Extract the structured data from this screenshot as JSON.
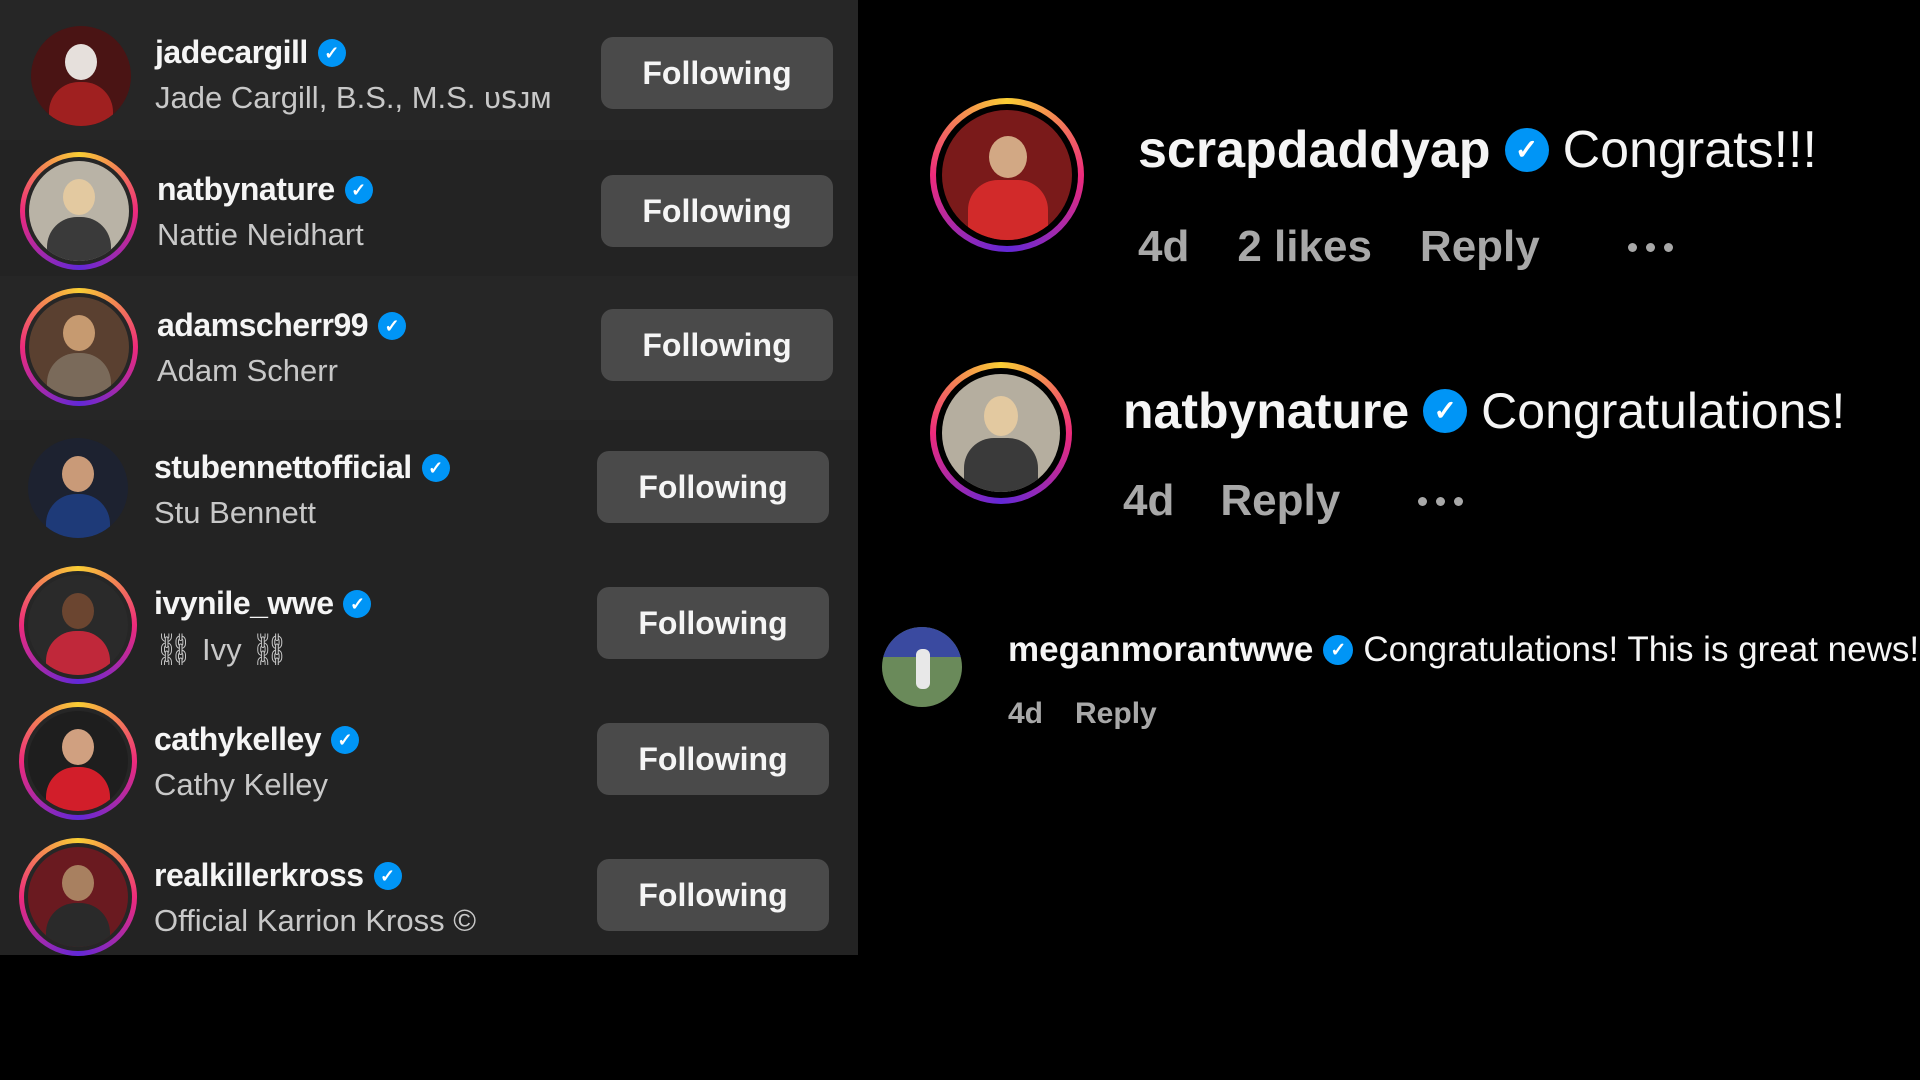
{
  "following_list": {
    "button_label": "Following",
    "accounts": [
      {
        "handle": "jadecargill",
        "name": "Jade Cargill, B.S., M.S. ᴜꜱᴊᴍ",
        "ring": false
      },
      {
        "handle": "natbynature",
        "name": "Nattie Neidhart",
        "ring": true
      },
      {
        "handle": "adamscherr99",
        "name": "Adam Scherr",
        "ring": true
      },
      {
        "handle": "stubennettofficial",
        "name": "Stu Bennett",
        "ring": false
      },
      {
        "handle": "ivynile_wwe",
        "name": "⛓ Ivy ⛓",
        "ring": true
      },
      {
        "handle": "cathykelley",
        "name": "Cathy Kelley",
        "ring": true
      },
      {
        "handle": "realkillerkross",
        "name": "Official Karrion Kross ©",
        "ring": true
      }
    ]
  },
  "comments": [
    {
      "handle": "scrapdaddyap",
      "text": "Congrats!!!",
      "age": "4d",
      "likes": "2 likes",
      "reply": "Reply"
    },
    {
      "handle": "natbynature",
      "text": "Congratulations!",
      "age": "4d",
      "reply": "Reply"
    },
    {
      "handle": "meganmorantwwe",
      "text": "Congratulations! This is great news!",
      "age": "4d",
      "reply": "Reply"
    }
  ],
  "icons": {
    "verified": "verified-badge-icon",
    "more": "more-options-icon"
  },
  "colors": {
    "panel_bg": "#262626",
    "button_bg": "#4a4a4a",
    "verified": "#0095f6",
    "muted_text": "#a8a8a8"
  }
}
